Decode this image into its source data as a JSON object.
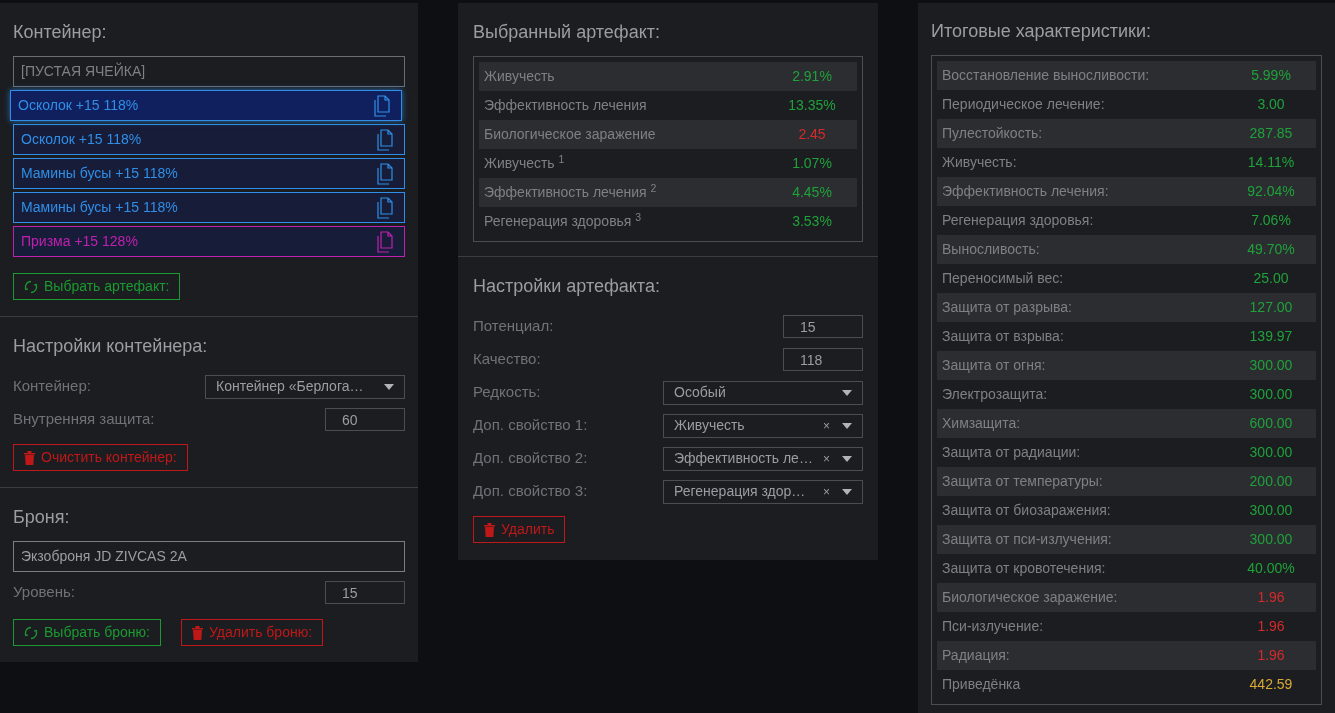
{
  "container_panel": {
    "title": "Контейнер:",
    "slots": [
      {
        "kind": "empty",
        "label": "[ПУСТАЯ ЯЧЕЙКА]",
        "selected": false
      },
      {
        "kind": "artifact",
        "label": "Осколок +15 118%",
        "color": "#2f8fe8",
        "selected": true
      },
      {
        "kind": "artifact",
        "label": "Осколок +15 118%",
        "color": "#2f8fe8",
        "selected": false
      },
      {
        "kind": "artifact",
        "label": "Мамины бусы +15 118%",
        "color": "#2f8fe8",
        "selected": false
      },
      {
        "kind": "artifact",
        "label": "Мамины бусы +15 118%",
        "color": "#2f8fe8",
        "selected": false
      },
      {
        "kind": "artifact",
        "label": "Призма +15 128%",
        "color": "#c020b0",
        "selected": false
      }
    ],
    "choose_button": "Выбрать артефакт:"
  },
  "container_settings": {
    "title": "Настройки контейнера:",
    "fields": [
      {
        "kind": "select",
        "label": "Контейнер:",
        "value": "Контейнер «Берлога…"
      },
      {
        "kind": "number",
        "label": "Внутренняя защита:",
        "value": "60"
      }
    ],
    "clear_button": "Очистить контейнер:"
  },
  "armor": {
    "title": "Броня:",
    "name": "Экзоброня JD ZIVCAS 2A",
    "fields": [
      {
        "kind": "number",
        "label": "Уровень:",
        "value": "15"
      }
    ],
    "choose_button": "Выбрать броню:",
    "remove_button": "Удалить броню:"
  },
  "selected_artifact": {
    "title": "Выбранный артефакт:",
    "rows": [
      {
        "label": "Живучесть",
        "value": "2.91%",
        "color": "#1fa23a"
      },
      {
        "label": "Эффективность лечения",
        "value": "13.35%",
        "color": "#1fa23a"
      },
      {
        "label": "Биологическое заражение",
        "value": "2.45",
        "color": "#d42a2a"
      },
      {
        "label": "Живучесть $^{1}$",
        "value": "1.07%",
        "color": "#1fa23a"
      },
      {
        "label": "Эффективность лечения $^{2}$",
        "value": "4.45%",
        "color": "#1fa23a"
      },
      {
        "label": "Регенерация здоровья $^{3}$",
        "value": "3.53%",
        "color": "#1fa23a"
      }
    ]
  },
  "artifact_settings": {
    "title": "Настройки артефакта:",
    "fields": [
      {
        "kind": "number",
        "label": "Потенциал:",
        "value": "15"
      },
      {
        "kind": "number",
        "label": "Качество:",
        "value": "118"
      },
      {
        "kind": "select",
        "label": "Редкость:",
        "value": "Особый"
      },
      {
        "kind": "select",
        "label": "Доп. свойство 1:",
        "value": "Живучесть",
        "clear": "×"
      },
      {
        "kind": "select",
        "label": "Доп. свойство 2:",
        "value": "Эффективность ле…",
        "clear": "×"
      },
      {
        "kind": "select",
        "label": "Доп. свойство 3:",
        "value": "Регенерация здор…",
        "clear": "×"
      }
    ],
    "delete_button": "Удалить"
  },
  "totals": {
    "title": "Итоговые характеристики:",
    "rows": [
      {
        "label": "Восстановление выносливости:",
        "value": "5.99%",
        "color": "#1fa23a"
      },
      {
        "label": "Периодическое лечение:",
        "value": "3.00",
        "color": "#1fa23a"
      },
      {
        "label": "Пулестойкость:",
        "value": "287.85",
        "color": "#1fa23a"
      },
      {
        "label": "Живучесть:",
        "value": "14.11%",
        "color": "#1fa23a"
      },
      {
        "label": "Эффективность лечения:",
        "value": "92.04%",
        "color": "#1fa23a"
      },
      {
        "label": "Регенерация здоровья:",
        "value": "7.06%",
        "color": "#1fa23a"
      },
      {
        "label": "Выносливость:",
        "value": "49.70%",
        "color": "#1fa23a"
      },
      {
        "label": "Переносимый вес:",
        "value": "25.00",
        "color": "#1fa23a"
      },
      {
        "label": "Защита от разрыва:",
        "value": "127.00",
        "color": "#1fa23a"
      },
      {
        "label": "Защита от взрыва:",
        "value": "139.97",
        "color": "#1fa23a"
      },
      {
        "label": "Защита от огня:",
        "value": "300.00",
        "color": "#1fa23a"
      },
      {
        "label": "Электрозащита:",
        "value": "300.00",
        "color": "#1fa23a"
      },
      {
        "label": "Химзащита:",
        "value": "600.00",
        "color": "#1fa23a"
      },
      {
        "label": "Защита от радиации:",
        "value": "300.00",
        "color": "#1fa23a"
      },
      {
        "label": "Защита от температуры:",
        "value": "200.00",
        "color": "#1fa23a"
      },
      {
        "label": "Защита от биозаражения:",
        "value": "300.00",
        "color": "#1fa23a"
      },
      {
        "label": "Защита от пси-излучения:",
        "value": "300.00",
        "color": "#1fa23a"
      },
      {
        "label": "Защита от кровотечения:",
        "value": "40.00%",
        "color": "#1fa23a"
      },
      {
        "label": "Биологическое заражение:",
        "value": "1.96",
        "color": "#d42a2a"
      },
      {
        "label": "Пси-излучение:",
        "value": "1.96",
        "color": "#d42a2a"
      },
      {
        "label": "Радиация:",
        "value": "1.96",
        "color": "#d42a2a"
      },
      {
        "label": "Приведёнка",
        "value": "442.59",
        "color": "#d8a935"
      }
    ]
  }
}
